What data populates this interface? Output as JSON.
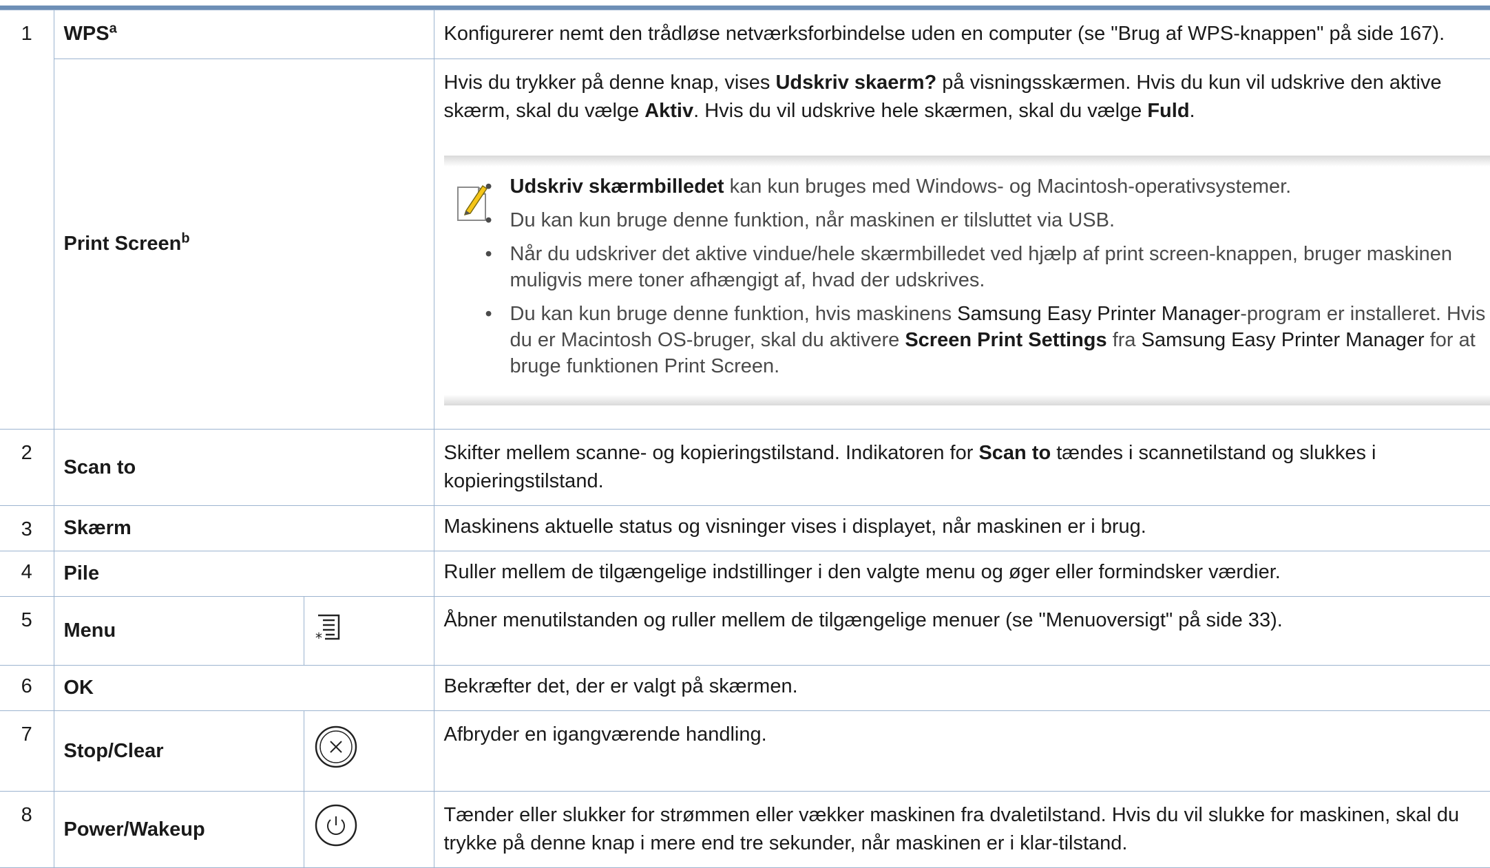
{
  "rows": [
    {
      "num": "1",
      "name": "WPS",
      "sup": "a",
      "desc": "Konfigurerer nemt den trådløse netværksforbindelse uden en computer (se \"Brug af WPS-knappen\" på side 167)."
    },
    {
      "name": "Print Screen",
      "sup": "b",
      "desc_parts": [
        "Hvis du trykker på denne knap, vises ",
        "Udskriv skaerm?",
        " på visningsskærmen. Hvis du kun vil udskrive den aktive skærm, skal du vælge ",
        "Aktiv",
        ". Hvis du vil udskrive hele skærmen, skal du vælge ",
        "Fuld",
        "."
      ],
      "note_icon": "note-pencil-icon",
      "note_items": [
        {
          "parts": [
            "Udskriv skærmbilledet",
            " kan kun bruges med Windows- og Macintosh-operativsystemer."
          ]
        },
        {
          "text": "Du kan kun bruge denne funktion, når maskinen er tilsluttet via USB."
        },
        {
          "text": "Når du udskriver det aktive vindue/hele skærmbilledet ved hjælp af print screen-knappen, bruger maskinen muligvis mere toner afhængigt af, hvad der udskrives."
        },
        {
          "parts": [
            "Du kan kun bruge denne funktion, hvis maskinens ",
            "Samsung Easy Printer Manager",
            "-program er installeret. Hvis du er Macintosh OS-bruger, skal du aktivere ",
            "Screen Print Settings",
            " fra ",
            "Samsung Easy Printer Manager",
            " for at bruge funktionen Print Screen."
          ]
        }
      ]
    },
    {
      "num": "2",
      "name": "Scan to",
      "desc_parts": [
        "Skifter mellem scanne- og kopieringstilstand. Indikatoren for ",
        "Scan to",
        " tændes i scannetilstand og slukkes i kopieringstilstand."
      ]
    },
    {
      "num": "3",
      "name": "Skærm",
      "desc": "Maskinens aktuelle status og visninger vises i displayet, når maskinen er i brug."
    },
    {
      "num": "4",
      "name": "Pile",
      "desc": "Ruller mellem de tilgængelige indstillinger i den valgte menu og øger eller formindsker værdier."
    },
    {
      "num": "5",
      "name": "Menu",
      "icon": "menu-icon",
      "desc": "Åbner menutilstanden og ruller mellem de tilgængelige menuer (se \"Menuoversigt\" på side 33)."
    },
    {
      "num": "6",
      "name": "OK",
      "desc": "Bekræfter det, der er valgt på skærmen."
    },
    {
      "num": "7",
      "name": "Stop/Clear",
      "icon": "stop-clear-icon",
      "desc": "Afbryder en igangværende handling."
    },
    {
      "num": "8",
      "name": "Power/Wakeup",
      "icon": "power-icon",
      "desc": "Tænder eller slukker for strømmen eller vækker maskinen fra dvaletilstand. Hvis du vil slukke for maskinen, skal du trykke på denne knap i mere end tre sekunder, når maskinen er i klar-tilstand."
    }
  ]
}
